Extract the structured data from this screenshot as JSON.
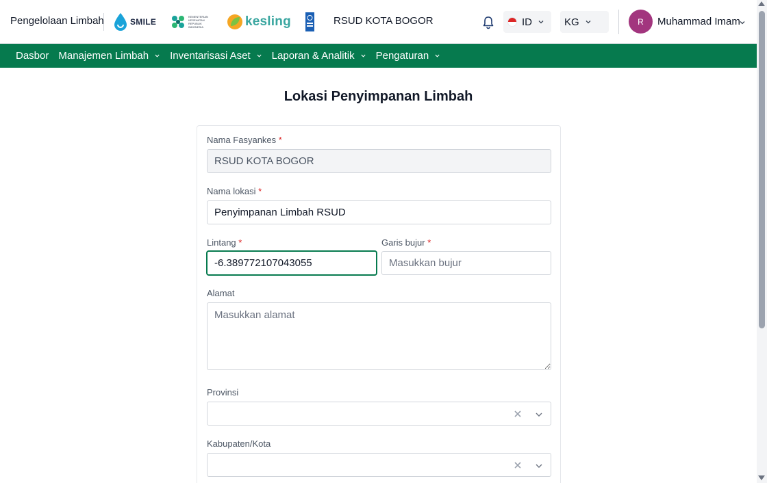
{
  "header": {
    "app_name": "Pengelolaan Limbah",
    "smile_logo_text": "SMILE",
    "kemenkes_logo_text": "KEMENTERIAN KESEHATAN REPUBLIK INDONESIA",
    "kesling_logo_text": "kesling",
    "hospital_name": "RSUD KOTA BOGOR",
    "language": "ID",
    "unit": "KG",
    "avatar_initial": "R",
    "user_name": "Muhammad Imam"
  },
  "nav": {
    "items": [
      {
        "label": "Dasbor",
        "has_dropdown": false
      },
      {
        "label": "Manajemen Limbah",
        "has_dropdown": true
      },
      {
        "label": "Inventarisasi Aset",
        "has_dropdown": true
      },
      {
        "label": "Laporan & Analitik",
        "has_dropdown": true
      },
      {
        "label": "Pengaturan",
        "has_dropdown": true
      }
    ]
  },
  "page": {
    "title": "Lokasi Penyimpanan Limbah"
  },
  "form": {
    "fasyankes": {
      "label": "Nama Fasyankes",
      "value": "RSUD KOTA BOGOR"
    },
    "lokasi": {
      "label": "Nama lokasi",
      "value": "Penyimpanan Limbah RSUD"
    },
    "lintang": {
      "label": "Lintang",
      "value": "-6.389772107043055"
    },
    "bujur": {
      "label": "Garis bujur",
      "value": "",
      "placeholder": "Masukkan bujur"
    },
    "alamat": {
      "label": "Alamat",
      "value": "",
      "placeholder": "Masukkan alamat"
    },
    "provinsi": {
      "label": "Provinsi"
    },
    "kabupaten": {
      "label": "Kabupaten/Kota"
    },
    "required_mark": "*"
  },
  "colors": {
    "brand_green": "#067a4e",
    "avatar": "#a2357e",
    "required": "#dc2626"
  }
}
